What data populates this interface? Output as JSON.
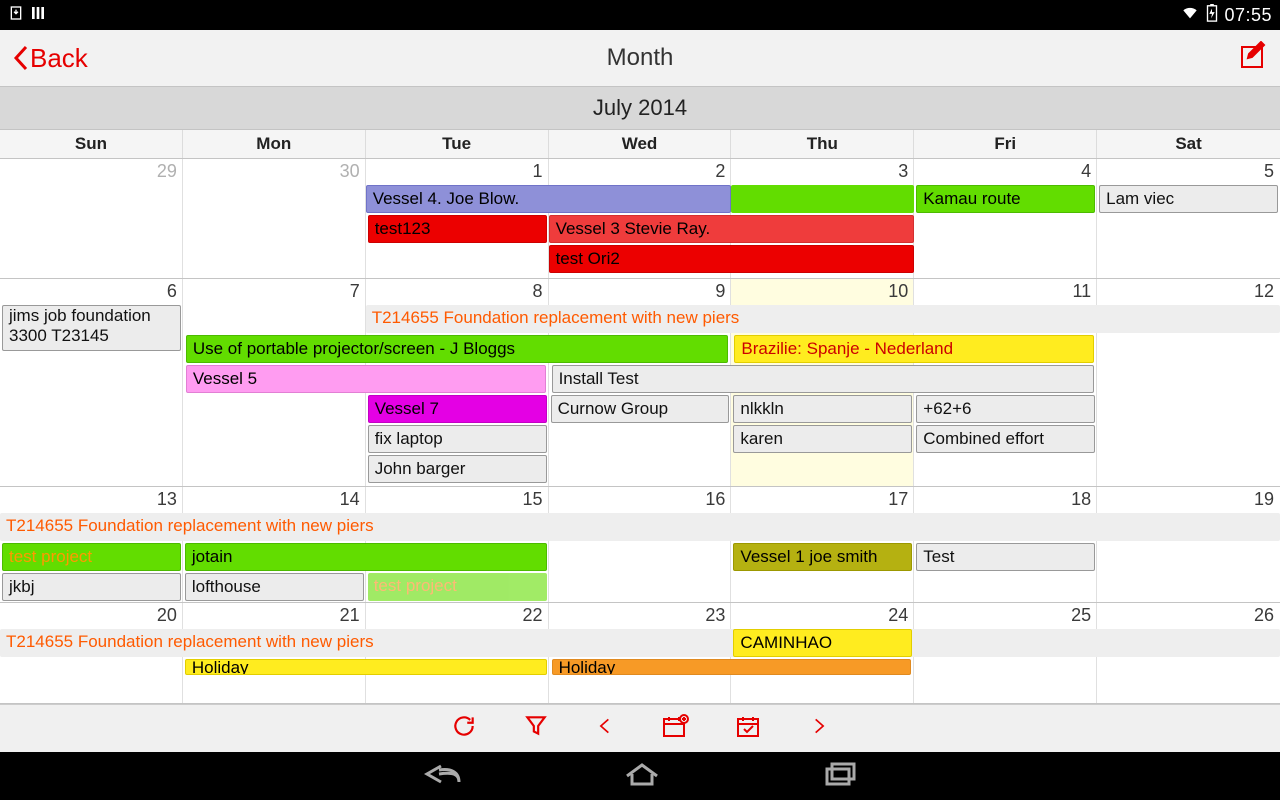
{
  "statusbar": {
    "time": "07:55"
  },
  "header": {
    "back_label": "Back",
    "title": "Month"
  },
  "month_title": "July 2014",
  "day_headers": [
    "Sun",
    "Mon",
    "Tue",
    "Wed",
    "Thu",
    "Fri",
    "Sat"
  ],
  "dates": {
    "w1": [
      "29",
      "30",
      "1",
      "2",
      "3",
      "4",
      "5"
    ],
    "w2": [
      "6",
      "7",
      "8",
      "9",
      "10",
      "11",
      "12"
    ],
    "w3": [
      "13",
      "14",
      "15",
      "16",
      "17",
      "18",
      "19"
    ],
    "w4": [
      "20",
      "21",
      "22",
      "23",
      "24",
      "25",
      "26"
    ]
  },
  "events": {
    "w1": {
      "vessel4": "Vessel 4. Joe Blow.",
      "kamau": "Kamau route",
      "lamviec": "Lam viec",
      "test123": "test123",
      "vessel3": "Vessel 3 Stevie Ray.",
      "testori2": "test Ori2"
    },
    "w2": {
      "jims": "jims job foundation 3300 T23145",
      "t214655": "T214655 Foundation replacement with new piers",
      "projector": "Use of portable projector/screen - J Bloggs",
      "brazilie": "Brazilie: Spanje - Nederland",
      "vessel5": "Vessel 5",
      "install": "Install Test",
      "vessel7": "Vessel 7",
      "curnow": "Curnow Group",
      "nlkkln": "nlkkln",
      "plus62": "+62+6",
      "fix": "fix laptop",
      "karen": "karen",
      "combined": "Combined effort",
      "barger": "John barger"
    },
    "w3": {
      "t214655": "T214655 Foundation replacement with new piers",
      "testproj": "test project",
      "jotain": "jotain",
      "vessel1": "Vessel 1 joe smith",
      "test": "Test",
      "jkbj": "jkbj",
      "lofthouse": "lofthouse",
      "testproj2": "test project"
    },
    "w4": {
      "t214655": "T214655 Foundation replacement with new piers",
      "caminhao": "CAMINHAO",
      "holiday1": "Holiday",
      "holiday2": "Holiday"
    }
  }
}
